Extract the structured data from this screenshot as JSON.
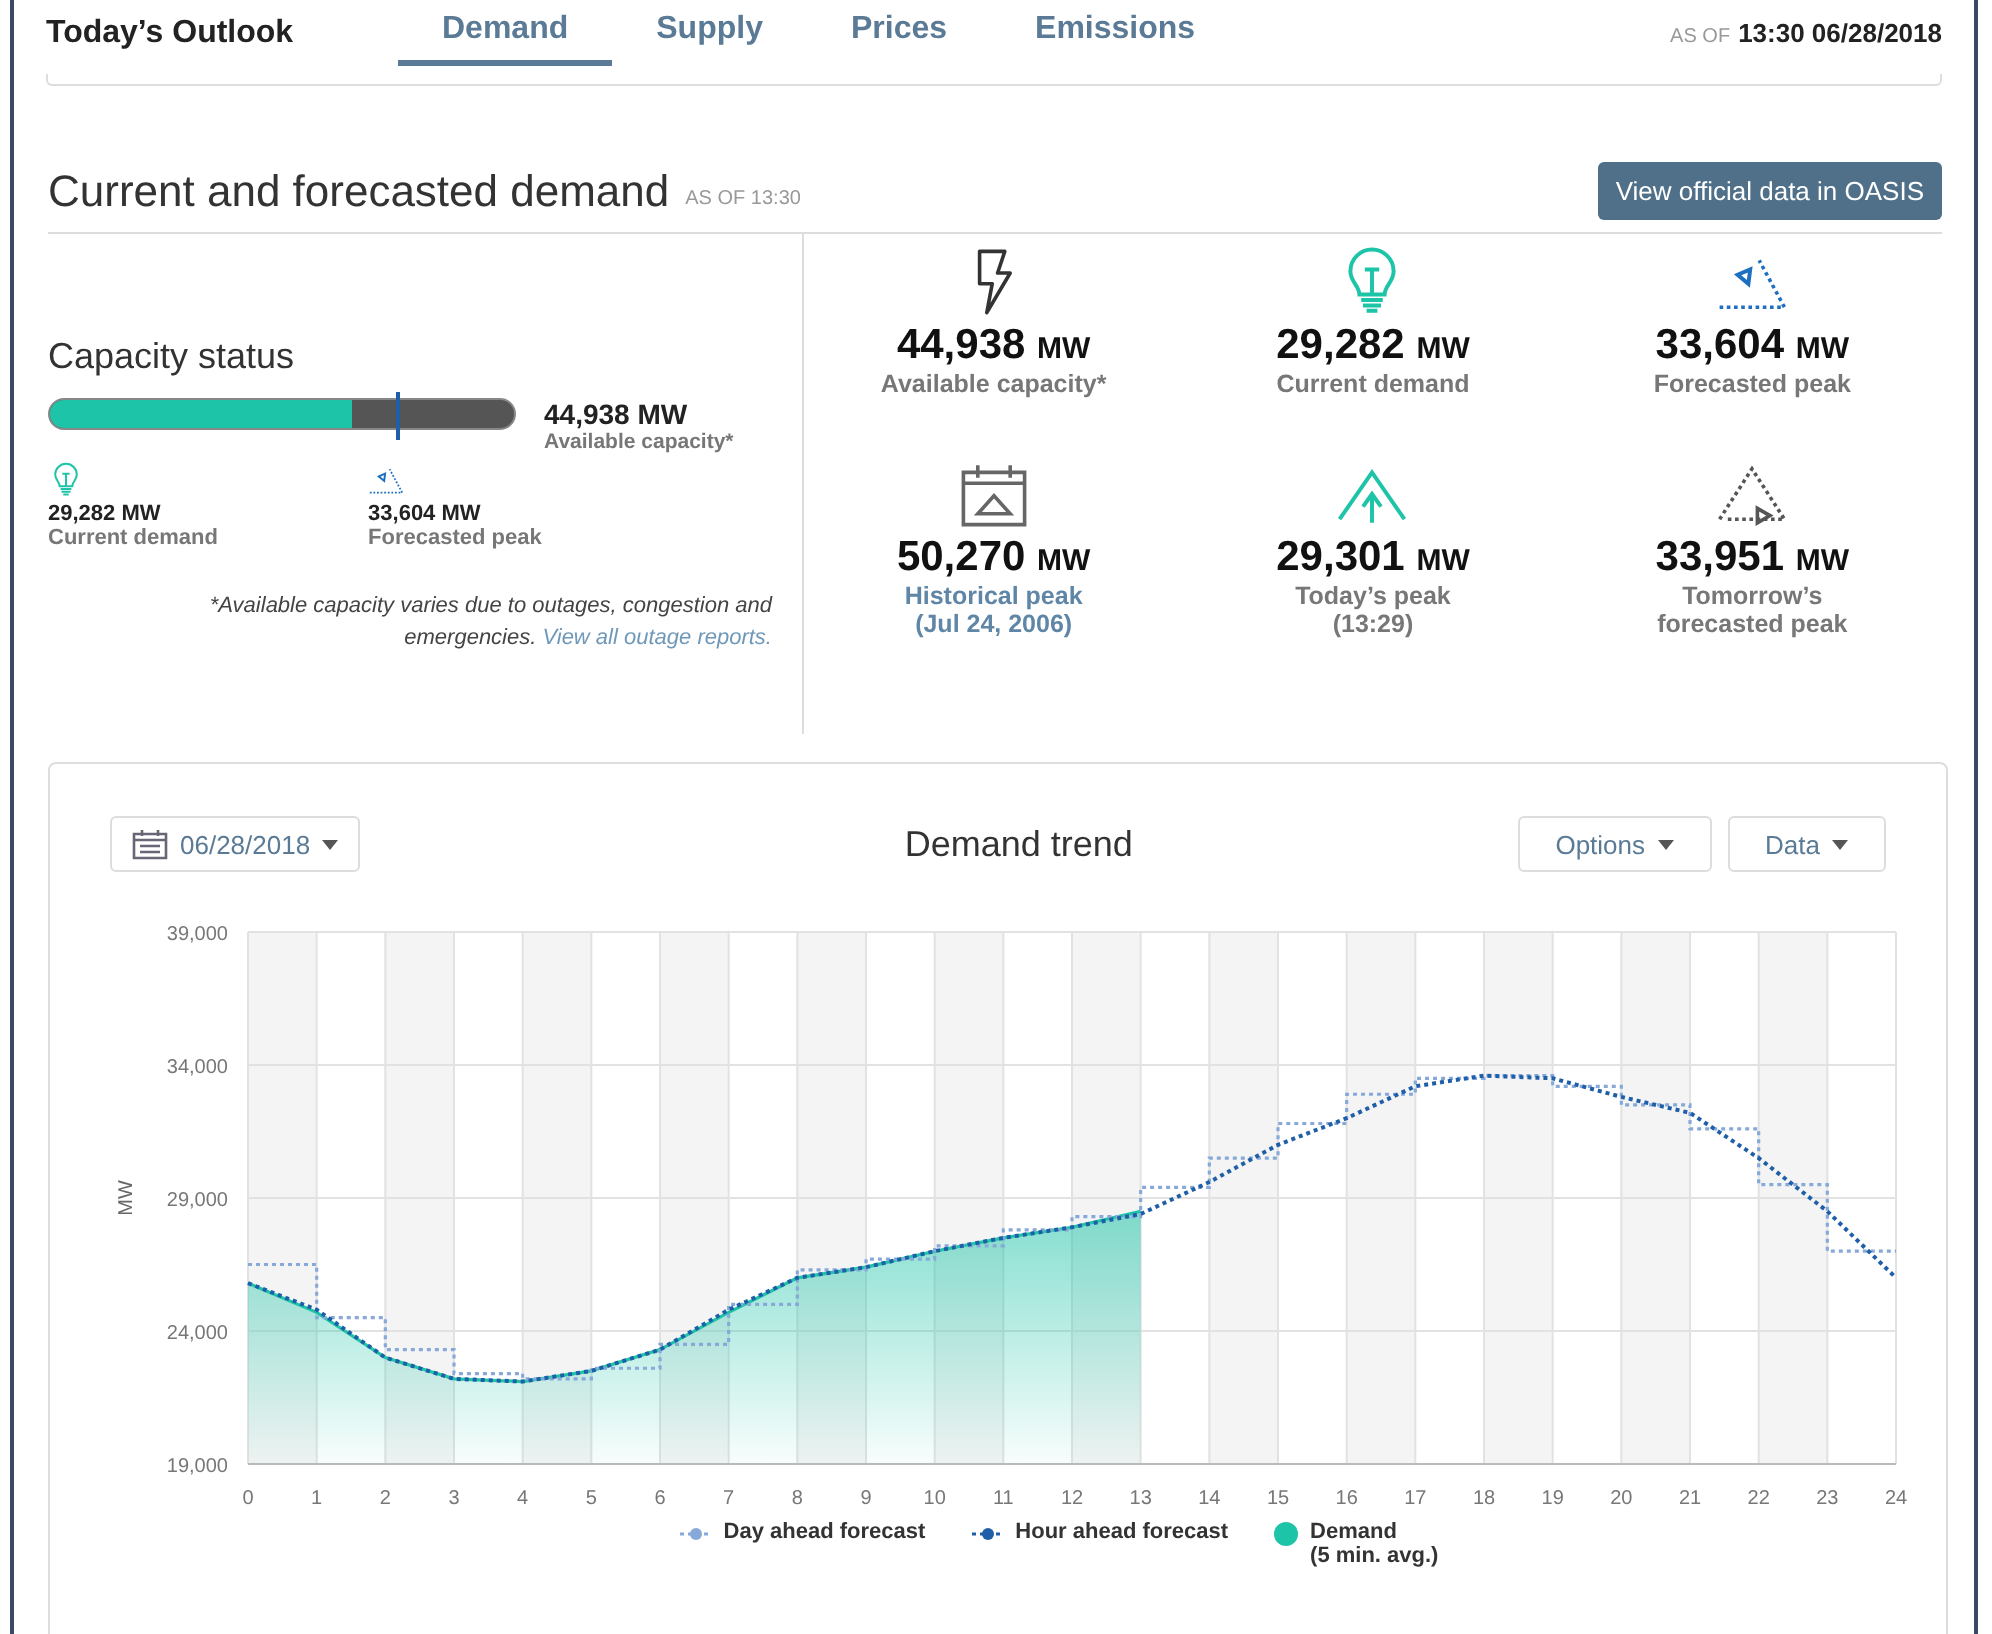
{
  "header": {
    "title": "Today’s Outlook",
    "as_of_label": "AS OF",
    "as_of_value": "13:30 06/28/2018",
    "tabs": [
      {
        "label": "Demand",
        "selected": true
      },
      {
        "label": "Supply",
        "selected": false
      },
      {
        "label": "Prices",
        "selected": false
      },
      {
        "label": "Emissions",
        "selected": false
      }
    ]
  },
  "section": {
    "title": "Current and forecasted demand",
    "as_of": "AS OF 13:30",
    "button": "View official data in OASIS"
  },
  "capacity": {
    "title": "Capacity status",
    "bar": {
      "level": 0.652,
      "marker": {
        "level": 0.748
      }
    },
    "total": "44,938 MW",
    "total_label": "Available capacity*",
    "current": {
      "value": "29,282 MW",
      "label": "Current demand"
    },
    "forecast": {
      "value": "33,604 MW",
      "label": "Forecasted peak"
    },
    "note": "*Available capacity varies due to outages, congestion and emergencies.",
    "note_link": "View all outage reports."
  },
  "stats": [
    {
      "value": "44,938",
      "unit": "MW",
      "link": false,
      "lines": [
        "Available capacity*"
      ]
    },
    {
      "value": "29,282",
      "unit": "MW",
      "link": false,
      "lines": [
        "Current demand"
      ]
    },
    {
      "value": "33,604",
      "unit": "MW",
      "link": false,
      "lines": [
        "Forecasted peak"
      ]
    },
    {
      "value": "50,270",
      "unit": "MW",
      "link": true,
      "lines": [
        "Historical peak",
        "(Jul 24, 2006)"
      ]
    },
    {
      "value": "29,301",
      "unit": "MW",
      "link": false,
      "lines": [
        "Today’s peak",
        "(13:29)"
      ]
    },
    {
      "value": "33,951",
      "unit": "MW",
      "link": false,
      "lines": [
        "Tomorrow’s",
        "forecasted peak"
      ]
    }
  ],
  "trend": {
    "date_button": "06/28/2018",
    "title": "Demand trend",
    "buttons": [
      "Options",
      "Data"
    ],
    "demand_legend_note": "(5 min. avg.)",
    "chart_data": {
      "type": "line",
      "ylabel": "MW",
      "x": [
        0,
        1,
        2,
        3,
        4,
        5,
        6,
        7,
        8,
        9,
        10,
        11,
        12,
        13,
        14,
        15,
        16,
        17,
        18,
        19,
        20,
        21,
        22,
        23,
        24
      ],
      "grid": true,
      "xlim": [
        0,
        24
      ],
      "ylim": [
        19000,
        39000
      ],
      "xticks": [
        0,
        1,
        2,
        3,
        4,
        5,
        6,
        7,
        8,
        9,
        10,
        11,
        12,
        13,
        14,
        15,
        16,
        17,
        18,
        19,
        20,
        21,
        22,
        23,
        24
      ],
      "yticks": [
        {
          "value": 19000,
          "label": "19,000"
        },
        {
          "value": 24000,
          "label": "24,000"
        },
        {
          "value": 29000,
          "label": "29,000"
        },
        {
          "value": 34000,
          "label": "34,000"
        },
        {
          "value": 39000,
          "label": "39,000"
        }
      ],
      "series": [
        {
          "name": "Day ahead forecast",
          "color": "#86a9d9",
          "line_style": "dotted-step",
          "x": [
            0,
            1,
            1,
            2,
            2,
            3,
            3,
            4,
            4,
            5,
            5,
            6,
            6,
            7,
            7,
            8,
            8,
            9,
            9,
            10,
            10,
            11,
            11,
            12,
            12,
            13,
            13,
            14,
            14,
            15,
            15,
            16,
            16,
            17,
            17,
            18,
            18,
            19,
            19,
            20,
            20,
            21,
            21,
            22,
            22,
            23,
            23,
            24
          ],
          "values": [
            26500,
            26500,
            24500,
            24500,
            23300,
            23300,
            22400,
            22400,
            22200,
            22200,
            22600,
            22600,
            23500,
            23500,
            25000,
            25000,
            26300,
            26300,
            26700,
            26700,
            27200,
            27200,
            27800,
            27800,
            28300,
            28300,
            29400,
            29400,
            30500,
            30500,
            31800,
            31800,
            32900,
            32900,
            33500,
            33500,
            33600,
            33600,
            33200,
            33200,
            32500,
            32500,
            31600,
            31600,
            29500,
            29500,
            27000,
            27000
          ]
        },
        {
          "name": "Hour ahead forecast",
          "color": "#1f5fa8",
          "line_style": "dotted",
          "values": [
            25800,
            24800,
            23000,
            22200,
            22100,
            22500,
            23300,
            24800,
            26000,
            26400,
            27000,
            27500,
            27900,
            28400,
            29600,
            31000,
            32000,
            33200,
            33600,
            33500,
            32800,
            32200,
            30500,
            28500,
            26000
          ]
        },
        {
          "name": "Demand",
          "color": "#1ec4a8",
          "line_style": "solid",
          "values": [
            25800,
            24700,
            23000,
            22200,
            22100,
            22500,
            23300,
            24700,
            26000,
            26400,
            27000,
            27500,
            27900,
            28500,
            null,
            null,
            null,
            null,
            null,
            null,
            null,
            null,
            null,
            null,
            null
          ]
        }
      ]
    }
  }
}
